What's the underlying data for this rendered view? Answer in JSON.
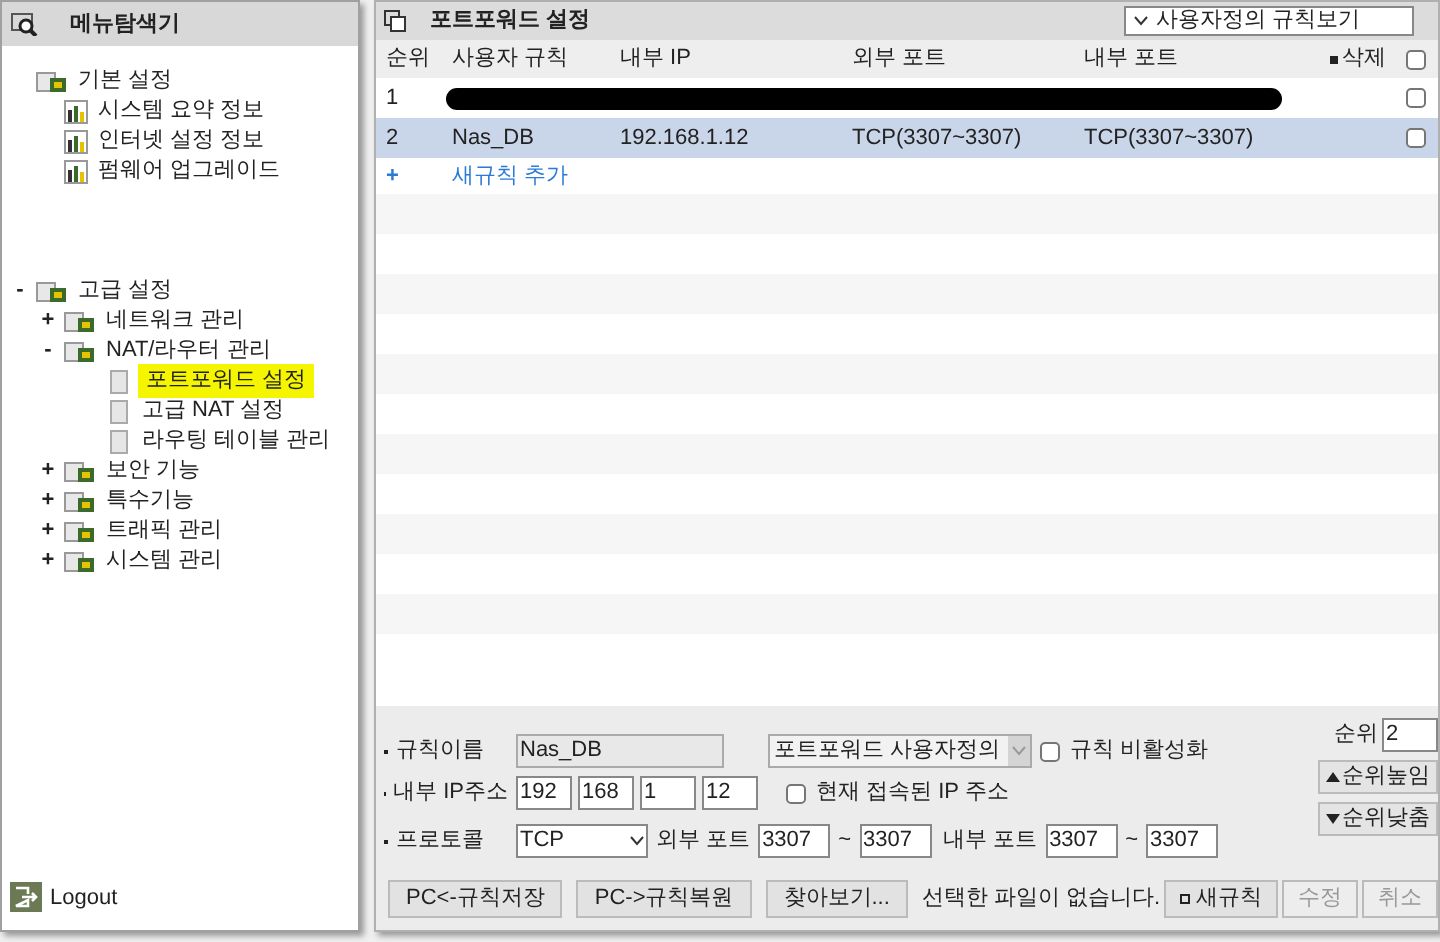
{
  "sidebar": {
    "title": "메뉴탐색기",
    "tree": [
      {
        "label": "기본 설정",
        "selected": false,
        "children": [
          {
            "label": "시스템 요약 정보",
            "selected": false
          },
          {
            "label": "인터넷 설정 정보",
            "selected": false
          },
          {
            "label": "펌웨어 업그레이드",
            "selected": false
          }
        ]
      },
      {
        "label": "고급 설정",
        "toggle": "-",
        "selected": false,
        "children": [
          {
            "label": "네트워크 관리",
            "toggle": "+",
            "selected": false
          },
          {
            "label": "NAT/라우터 관리",
            "toggle": "-",
            "selected": false,
            "children": [
              {
                "label": "포트포워드 설정",
                "selected": true
              },
              {
                "label": "고급 NAT 설정",
                "selected": false
              },
              {
                "label": "라우팅 테이블 관리",
                "selected": false
              }
            ]
          },
          {
            "label": "보안 기능",
            "toggle": "+",
            "selected": false
          },
          {
            "label": "특수기능",
            "toggle": "+",
            "selected": false
          },
          {
            "label": "트래픽 관리",
            "toggle": "+",
            "selected": false
          },
          {
            "label": "시스템 관리",
            "toggle": "+",
            "selected": false
          }
        ]
      }
    ],
    "logout": "Logout"
  },
  "panel": {
    "title": "포트포워드 설정",
    "view_select": "사용자정의 규칙보기"
  },
  "table": {
    "columns": [
      "순위",
      "사용자 규칙",
      "내부 IP",
      "외부 포트",
      "내부 포트",
      "삭제"
    ],
    "header_checked": false,
    "rows": [
      {
        "cells": [
          "1"
        ],
        "redacted": true,
        "selected": false,
        "checked": false
      },
      {
        "cells": [
          "2",
          "Nas_DB",
          "192.168.1.12",
          "TCP(3307~3307)",
          "TCP(3307~3307)"
        ],
        "redacted": false,
        "selected": true,
        "checked": false
      }
    ],
    "add_row": {
      "icon": "+",
      "label": "새규칙 추가"
    }
  },
  "form": {
    "name_label": "규칙이름",
    "name_value": "Nas_DB",
    "type_select": "포트포워드 사용자정의",
    "disable_label": "규칙 비활성화",
    "disable_checked": false,
    "ip_label": "내부 IP주소",
    "ip": [
      "192",
      "168",
      "1",
      "12"
    ],
    "current_ip_label": "현재 접속된 IP 주소",
    "current_ip_checked": false,
    "protocol_label": "프로토콜",
    "protocol": "TCP",
    "ext_port_label": "외부 포트",
    "ext_port": [
      "3307",
      "3307"
    ],
    "int_port_label": "내부 포트",
    "int_port": [
      "3307",
      "3307"
    ],
    "range_sep": "~",
    "rank_label": "순위",
    "rank_value": "2",
    "rank_up": "순위높임",
    "rank_down": "순위낮춤",
    "file_buttons": [
      "PC<-규칙저장",
      "PC->규칙복원",
      "찾아보기..."
    ],
    "file_status": "선택한 파일이 없습니다.",
    "actions": [
      {
        "label": "새규칙",
        "disabled": false
      },
      {
        "label": "수정",
        "disabled": true
      },
      {
        "label": "취소",
        "disabled": true
      }
    ]
  }
}
